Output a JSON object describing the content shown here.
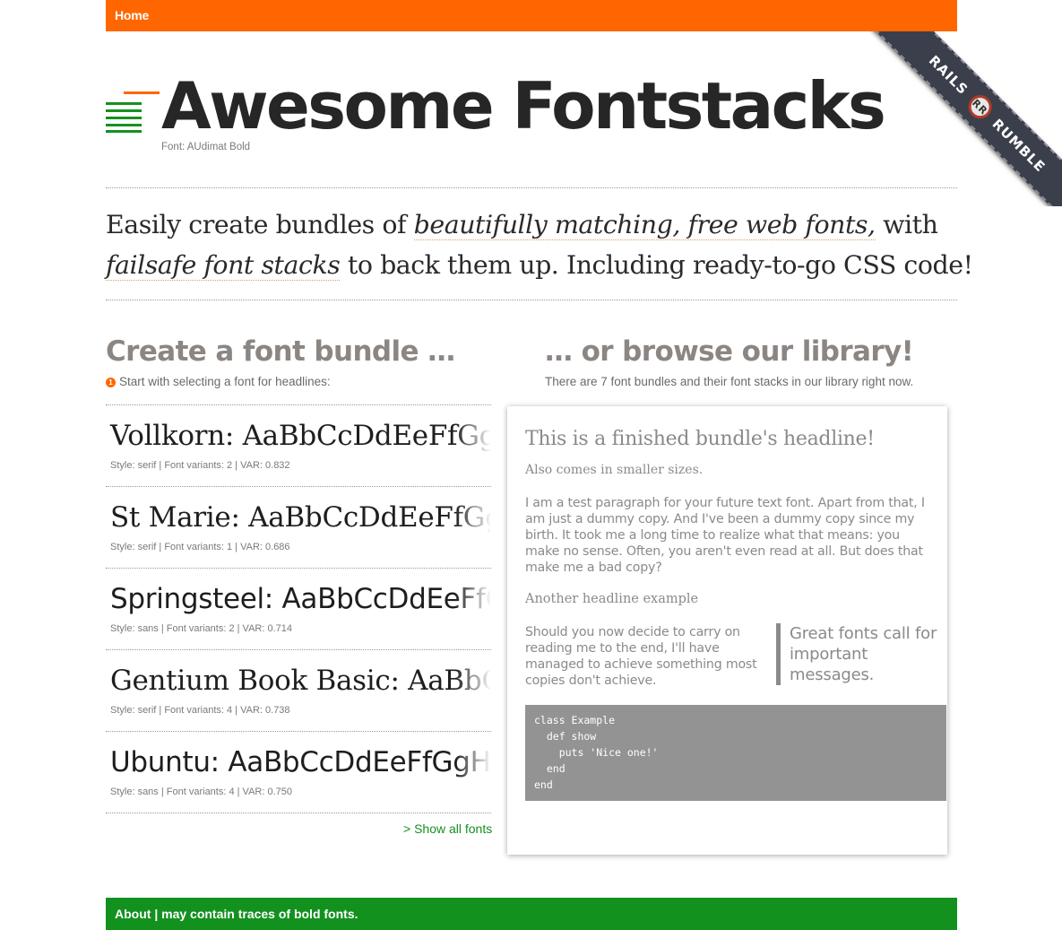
{
  "nav": {
    "home_label": "Home"
  },
  "ribbon": {
    "left": "RAILS",
    "badge": "RR",
    "right": "RUMBLE"
  },
  "header": {
    "title": "Awesome Fontstacks",
    "font_note": "Font: AUdimat Bold"
  },
  "intro": {
    "part1": "Easily create bundles of ",
    "highlight1": "beautifully matching, free web fonts,",
    "part2": " with",
    "highlight2": "failsafe font stacks",
    "part3": " to back them up. Including ready-to-go CSS code!"
  },
  "create": {
    "heading": "Create a font bundle …",
    "step_number": "1",
    "instruction": "Start with selecting a font for headlines:",
    "fonts": [
      {
        "sample": "Vollkorn: AaBbCcDdEeFfGgHhIiJjKk",
        "meta": "Style: serif | Font variants: 2 | VAR: 0.832",
        "style": "serif"
      },
      {
        "sample": "St Marie: AaBbCcDdEeFfGgHhIiJjKk",
        "meta": "Style: serif | Font variants: 1 | VAR: 0.686",
        "style": "serif"
      },
      {
        "sample": "Springsteel: AaBbCcDdEeFfGgHhIi",
        "meta": "Style: sans | Font variants: 2 | VAR: 0.714",
        "style": "sans"
      },
      {
        "sample": "Gentium Book Basic: AaBbCcDdEe",
        "meta": "Style: serif | Font variants: 4 | VAR: 0.738",
        "style": "serif"
      },
      {
        "sample": "Ubuntu: AaBbCcDdEeFfGgHhIiJjKk",
        "meta": "Style: sans | Font variants: 4 | VAR: 0.750",
        "style": "sans"
      }
    ],
    "show_all": "> Show all fonts"
  },
  "library": {
    "heading": "… or browse our library!",
    "description": "There are 7 font bundles and their font stacks in our library right now."
  },
  "preview": {
    "headline": "This is a finished bundle's headline!",
    "small": "Also comes in smaller sizes.",
    "paragraph": "I am a test paragraph for your future text font. Apart from that, I am just a dummy copy. And I've been a dummy copy since my birth. It took me a long time to realize what that means: you make no sense. Often, you aren't even read at all. But does that make me a bad copy?",
    "headline2": "Another headline example",
    "paragraph2": "Should you now decide to carry on reading me to the end, I'll have managed to achieve something most copies don't achieve.",
    "quote": "Great fonts call for important messages.",
    "code": "class Example\n  def show\n    puts 'Nice one!'\n  end\nend"
  },
  "footer": {
    "text": "About | may contain traces of bold fonts."
  }
}
